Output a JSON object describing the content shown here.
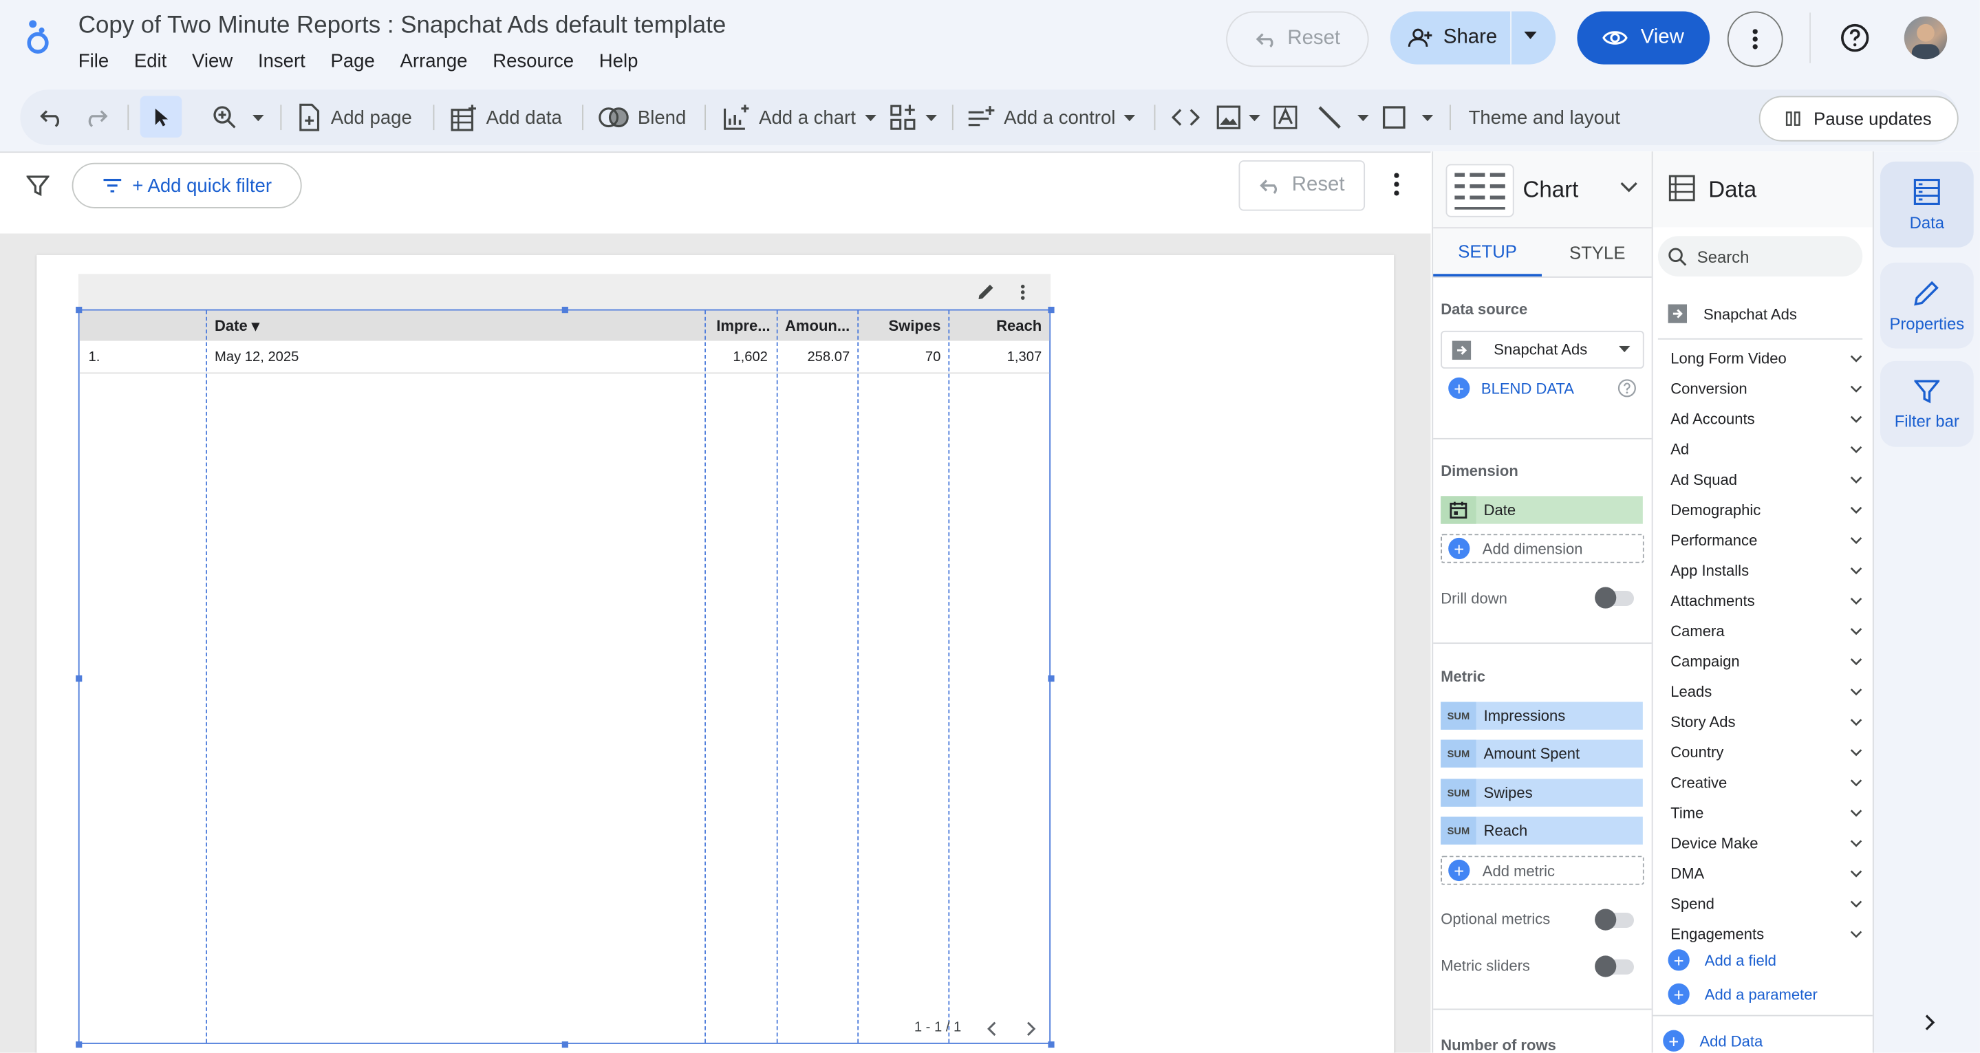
{
  "header": {
    "title": "Copy of Two Minute Reports : Snapchat Ads default template",
    "menu": [
      "File",
      "Edit",
      "View",
      "Insert",
      "Page",
      "Arrange",
      "Resource",
      "Help"
    ],
    "reset_label": "Reset",
    "share_label": "Share",
    "view_label": "View"
  },
  "toolbar": {
    "add_page": "Add page",
    "add_data": "Add data",
    "blend": "Blend",
    "add_chart": "Add a chart",
    "add_control": "Add a control",
    "theme": "Theme and layout",
    "pause": "Pause updates"
  },
  "filterbar": {
    "quick_filter": "+ Add quick filter",
    "reset_label": "Reset"
  },
  "table": {
    "columns": [
      "Date ▾",
      "Impre...",
      "Amoun...",
      "Swipes",
      "Reach"
    ],
    "rows": [
      {
        "index": "1.",
        "date": "May 12, 2025",
        "impressions": "1,602",
        "amount": "258.07",
        "swipes": "70",
        "reach": "1,307"
      }
    ],
    "pagination": "1 - 1 / 1"
  },
  "chart_panel": {
    "title": "Chart",
    "tab_setup": "SETUP",
    "tab_style": "STYLE",
    "data_source_label": "Data source",
    "data_source_value": "Snapchat Ads",
    "blend_data": "BLEND DATA",
    "dimension_label": "Dimension",
    "dimension": "Date",
    "add_dimension": "Add dimension",
    "drill_down": "Drill down",
    "metric_label": "Metric",
    "metric_tag": "SUM",
    "metrics": [
      "Impressions",
      "Amount Spent",
      "Swipes",
      "Reach"
    ],
    "add_metric": "Add metric",
    "optional_metrics": "Optional metrics",
    "metric_sliders": "Metric sliders",
    "number_of_rows": "Number of rows"
  },
  "data_panel": {
    "title": "Data",
    "search_placeholder": "Search",
    "source": "Snapchat Ads",
    "fields": [
      "Long Form Video",
      "Conversion",
      "Ad Accounts",
      "Ad",
      "Ad Squad",
      "Demographic",
      "Performance",
      "App Installs",
      "Attachments",
      "Camera",
      "Campaign",
      "Leads",
      "Story Ads",
      "Country",
      "Creative",
      "Time",
      "Device Make",
      "DMA",
      "Spend",
      "Engagements"
    ],
    "add_field": "Add a field",
    "add_parameter": "Add a parameter",
    "add_data": "Add Data"
  },
  "rail": {
    "data": "Data",
    "properties": "Properties",
    "filter_bar": "Filter bar"
  },
  "colors": {
    "accent": "#1a5fd0",
    "dimension_chip": "#c8e6c9",
    "metric_chip": "#c2dcfa",
    "selection": "#4f7ddb"
  }
}
